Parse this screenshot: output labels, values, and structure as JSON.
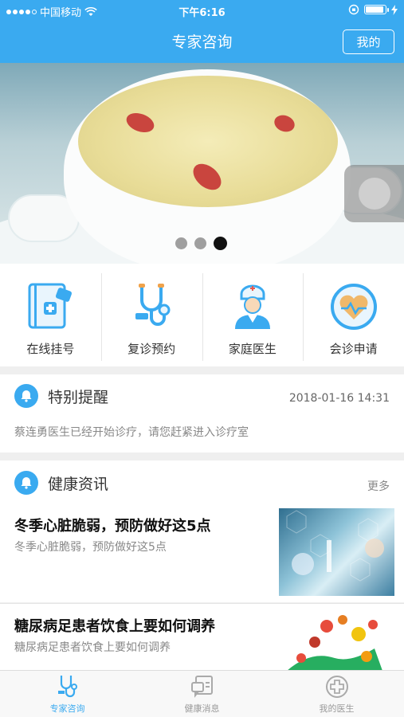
{
  "status_bar": {
    "carrier": "中国移动",
    "time": "下午6:16"
  },
  "nav": {
    "title": "专家咨询",
    "mine_button": "我的"
  },
  "banner": {
    "page_count": 3,
    "active_page": 3
  },
  "menu": {
    "items": [
      {
        "label": "在线挂号",
        "icon": "registration-book-icon"
      },
      {
        "label": "复诊预约",
        "icon": "stethoscope-icon"
      },
      {
        "label": "家庭医生",
        "icon": "doctor-icon"
      },
      {
        "label": "会诊申请",
        "icon": "heart-consult-icon"
      }
    ]
  },
  "reminder": {
    "title": "特别提醒",
    "time": "2018-01-16 14:31",
    "message": "蔡连勇医生已经开始诊疗，请您赶紧进入诊疗室"
  },
  "health_news": {
    "title": "健康资讯",
    "more": "更多",
    "items": [
      {
        "title": "冬季心脏脆弱，预防做好这5点",
        "subtitle": "冬季心脏脆弱，预防做好这5点"
      },
      {
        "title": "糖尿病足患者饮食上要如何调养",
        "subtitle": "糖尿病足患者饮食上要如何调养"
      }
    ]
  },
  "tabbar": {
    "tabs": [
      {
        "label": "专家咨询",
        "active": true
      },
      {
        "label": "健康消息",
        "active": false
      },
      {
        "label": "我的医生",
        "active": false
      }
    ]
  },
  "colors": {
    "primary": "#3aaaf0",
    "text_dark": "#333333",
    "text_muted": "#888888"
  }
}
